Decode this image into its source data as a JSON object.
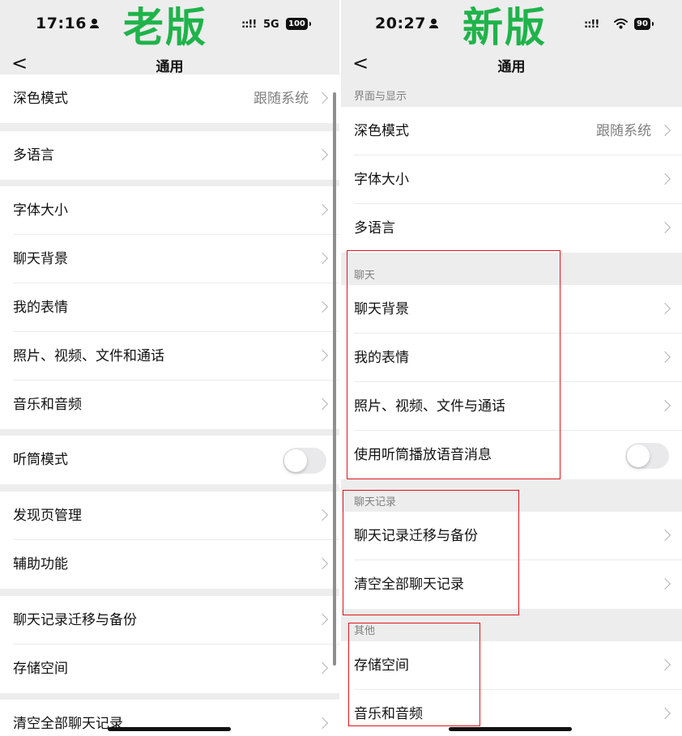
{
  "left": {
    "status": {
      "time": "17:16",
      "version_label": "老版",
      "signal": "::!!",
      "network": "5G",
      "battery": "100"
    },
    "nav": {
      "back_label": "<",
      "title": "通用"
    },
    "rows": [
      {
        "label": "深色模式",
        "value": "跟随系统"
      },
      {
        "label": "多语言"
      },
      {
        "label": "字体大小"
      },
      {
        "label": "聊天背景"
      },
      {
        "label": "我的表情"
      },
      {
        "label": "照片、视频、文件和通话"
      },
      {
        "label": "音乐和音频"
      },
      {
        "label": "听筒模式",
        "toggle": false
      },
      {
        "label": "发现页管理"
      },
      {
        "label": "辅助功能"
      },
      {
        "label": "聊天记录迁移与备份"
      },
      {
        "label": "存储空间"
      },
      {
        "label": "清空全部聊天记录"
      }
    ]
  },
  "right": {
    "status": {
      "time": "20:27",
      "version_label": "新版",
      "signal": "::!!",
      "battery": "90"
    },
    "nav": {
      "back_label": "<",
      "title": "通用"
    },
    "sections": [
      {
        "header": "界面与显示",
        "rows": [
          {
            "label": "深色模式",
            "value": "跟随系统"
          },
          {
            "label": "字体大小"
          },
          {
            "label": "多语言"
          }
        ]
      },
      {
        "header": "聊天",
        "rows": [
          {
            "label": "聊天背景"
          },
          {
            "label": "我的表情"
          },
          {
            "label": "照片、视频、文件与通话"
          },
          {
            "label": "使用听筒播放语音消息",
            "toggle": false
          }
        ]
      },
      {
        "header": "聊天记录",
        "rows": [
          {
            "label": "聊天记录迁移与备份"
          },
          {
            "label": "清空全部聊天记录"
          }
        ]
      },
      {
        "header": "其他",
        "rows": [
          {
            "label": "存储空间"
          },
          {
            "label": "音乐和音频"
          }
        ]
      }
    ]
  },
  "colors": {
    "version_label": "#1fb34a",
    "highlight_box": "#e0141b",
    "page_bg": "#ededed",
    "cell_bg": "#ffffff",
    "secondary_text": "#7f7f7f"
  },
  "icons": {
    "back": "chevron-left-icon",
    "row_arrow": "chevron-right-icon",
    "user": "person-icon",
    "wifi": "wifi-icon"
  }
}
